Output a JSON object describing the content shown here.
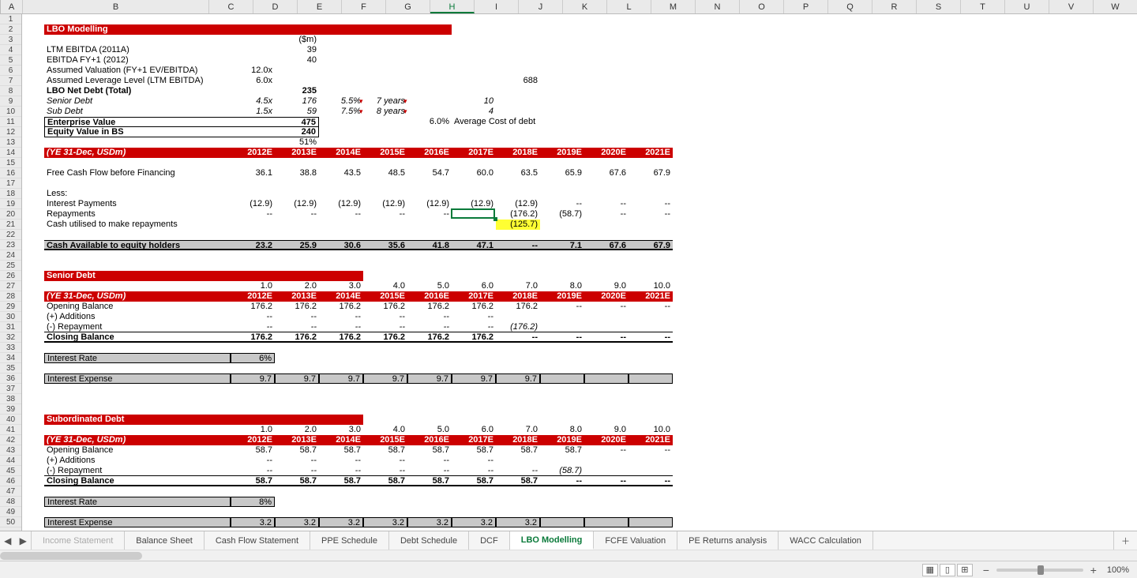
{
  "cols": {
    "A": 28,
    "B": 236,
    "C": 56,
    "D": 56,
    "E": 56,
    "F": 56,
    "G": 56,
    "H": 56,
    "I": 56,
    "J": 56,
    "K": 56,
    "L": 56,
    "M": 56,
    "N": 56,
    "O": 56,
    "P": 56,
    "Q": 56,
    "R": 56,
    "S": 56,
    "T": 56,
    "U": 56,
    "V": 56,
    "W": 56
  },
  "active_cell_col": "H",
  "active_cell_row": 20,
  "rows_count": 50,
  "tabs": {
    "items": [
      "Income Statement",
      "Balance Sheet",
      "Cash Flow Statement",
      "PPE Schedule",
      "Debt Schedule",
      "DCF",
      "LBO Modelling",
      "FCFE Valuation",
      "PE Returns analysis",
      "WACC Calculation"
    ],
    "active_index": 6
  },
  "status": {
    "zoom": "100%"
  },
  "labels": {
    "title": "LBO Modelling",
    "dollars_m": "($m)",
    "ltm_ebitda": "LTM EBITDA (2011A)",
    "ebitda_fy1": "EBITDA FY+1 (2012)",
    "valuation": "Assumed Valuation (FY+1 EV/EBITDA)",
    "leverage": "Assumed Leverage Level (LTM EBITDA)",
    "lbo_net_debt": "LBO Net Debt (Total)",
    "senior_debt": "Senior Debt",
    "sub_debt": "Sub Debt",
    "ev": "Enterprise Value",
    "equity_bs": "Equity Value in BS",
    "avg_cost": "Average Cost of debt",
    "ye_header": "(YE 31-Dec, USDm)",
    "fcf_before": "Free Cash Flow before Financing",
    "less": "Less:",
    "int_pmts": "Interest Payments",
    "repayments": "Repayments",
    "cash_util": "Cash utilised to make repayments",
    "cash_avail": "Cash Available to equity holders",
    "senior_debt_sec": "Senior Debt",
    "opening_bal": "Opening Balance",
    "additions": "(+) Additions",
    "repayment": "(-) Repayment",
    "closing_bal": "Closing Balance",
    "int_rate": "Interest Rate",
    "int_expense": "Interest Expense",
    "sub_debt_sec": "Subordinated Debt"
  },
  "vals": {
    "ltm_ebitda": "39",
    "ebitda_fy1": "40",
    "valuation_mult": "12.0x",
    "leverage_mult": "6.0x",
    "leverage_688": "688",
    "net_debt": "235",
    "senior_mult": "4.5x",
    "senior_amt": "176",
    "senior_rate": "5.5%",
    "senior_yrs": "7 years",
    "senior_n": "10",
    "sub_mult": "1.5x",
    "sub_amt": "59",
    "sub_rate": "7.5%",
    "sub_yrs": "8 years",
    "sub_n": "4",
    "ev": "475",
    "equity_bs": "240",
    "pct51": "51%",
    "avg_cost_pct": "6.0%"
  },
  "years": [
    "2012E",
    "2013E",
    "2014E",
    "2015E",
    "2016E",
    "2017E",
    "2018E",
    "2019E",
    "2020E",
    "2021E"
  ],
  "idx_1_10": [
    "1.0",
    "2.0",
    "3.0",
    "4.0",
    "5.0",
    "6.0",
    "7.0",
    "8.0",
    "9.0",
    "10.0"
  ],
  "fcf": [
    "36.1",
    "38.8",
    "43.5",
    "48.5",
    "54.7",
    "60.0",
    "63.5",
    "65.9",
    "67.6",
    "67.9"
  ],
  "int_pmts": [
    "(12.9)",
    "(12.9)",
    "(12.9)",
    "(12.9)",
    "(12.9)",
    "(12.9)",
    "(12.9)",
    "--",
    "--",
    "--"
  ],
  "repayments": [
    "--",
    "--",
    "--",
    "--",
    "--",
    "--",
    "(176.2)",
    "(58.7)",
    "--",
    "--"
  ],
  "cash_util": [
    "",
    "",
    "",
    "",
    "",
    "",
    "(125.7)",
    "",
    "",
    ""
  ],
  "cash_avail": [
    "23.2",
    "25.9",
    "30.6",
    "35.6",
    "41.8",
    "47.1",
    "--",
    "7.1",
    "67.6",
    "67.9"
  ],
  "senior_open": [
    "176.2",
    "176.2",
    "176.2",
    "176.2",
    "176.2",
    "176.2",
    "176.2",
    "--",
    "--",
    "--"
  ],
  "senior_add": [
    "--",
    "--",
    "--",
    "--",
    "--",
    "--",
    "",
    "",
    "",
    ""
  ],
  "senior_rep": [
    "--",
    "--",
    "--",
    "--",
    "--",
    "--",
    "(176.2)",
    "",
    "",
    ""
  ],
  "senior_close": [
    "176.2",
    "176.2",
    "176.2",
    "176.2",
    "176.2",
    "176.2",
    "--",
    "--",
    "--",
    "--"
  ],
  "senior_rate": "6%",
  "senior_intexp": [
    "9.7",
    "9.7",
    "9.7",
    "9.7",
    "9.7",
    "9.7",
    "9.7",
    "",
    "",
    ""
  ],
  "sub_open": [
    "58.7",
    "58.7",
    "58.7",
    "58.7",
    "58.7",
    "58.7",
    "58.7",
    "58.7",
    "--",
    "--"
  ],
  "sub_add": [
    "--",
    "--",
    "--",
    "--",
    "--",
    "--",
    "",
    "",
    "",
    ""
  ],
  "sub_rep": [
    "--",
    "--",
    "--",
    "--",
    "--",
    "--",
    "--",
    "(58.7)",
    "",
    ""
  ],
  "sub_close": [
    "58.7",
    "58.7",
    "58.7",
    "58.7",
    "58.7",
    "58.7",
    "58.7",
    "--",
    "--",
    "--"
  ],
  "sub_rate": "8%",
  "sub_intexp": [
    "3.2",
    "3.2",
    "3.2",
    "3.2",
    "3.2",
    "3.2",
    "3.2",
    "",
    "",
    ""
  ]
}
